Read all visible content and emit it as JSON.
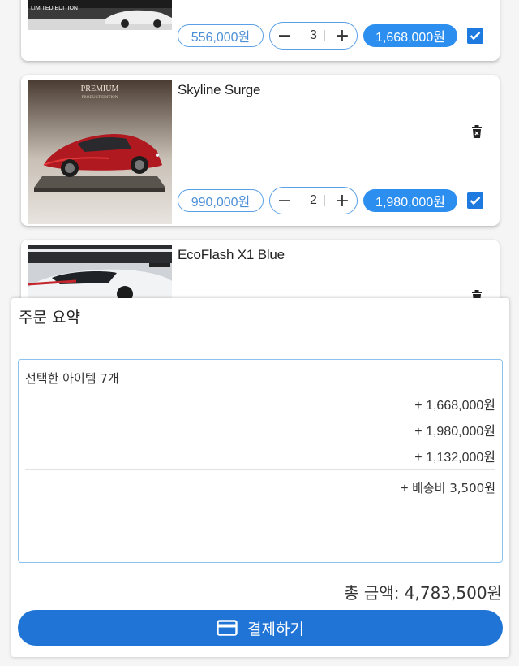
{
  "items": [
    {
      "title": "",
      "image_badge": "LIMITED EDITION",
      "unit_price": "556,000원",
      "quantity": "3",
      "line_total": "1,668,000원",
      "checked": true
    },
    {
      "title": "Skyline Surge",
      "image_badge": "PREMIUM",
      "image_sub": "PRODUCT EDITION",
      "unit_price": "990,000원",
      "quantity": "2",
      "line_total": "1,980,000원",
      "checked": true
    },
    {
      "title": "EcoFlash X1 Blue",
      "checked": true
    }
  ],
  "summary": {
    "title": "주문 요약",
    "selected_items": "선택한 아이템 7개",
    "lines": [
      "+ 1,668,000원",
      "+ 1,980,000원",
      "+ 1,132,000원"
    ],
    "shipping_prefix": "+ ",
    "shipping": "배송비 3,500원",
    "total": "총 금액: 4,783,500원",
    "pay_label": "결제하기"
  },
  "colors": {
    "accent": "#2c8ff0",
    "pay_button": "#1f74d6",
    "outline": "#5aa0e6"
  },
  "icons": {
    "minus": "minus-icon",
    "plus": "plus-icon",
    "check": "checkbox-checked-icon",
    "trash": "trash-icon",
    "pay": "credit-card-icon"
  }
}
